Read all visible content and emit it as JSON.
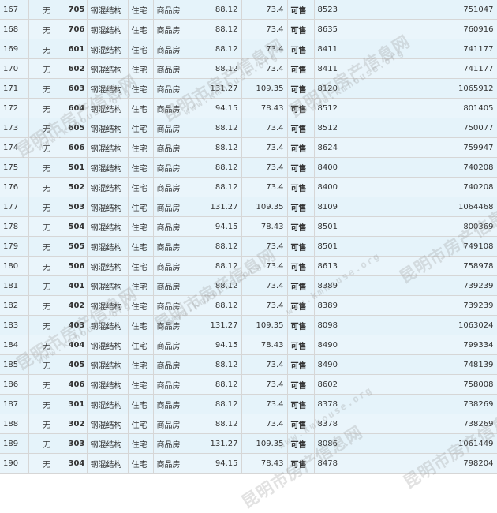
{
  "watermark": {
    "cn": "昆明市房产信息网",
    "en": "www.kmhouse.org"
  },
  "status_color": "#0a7a0a",
  "rows": [
    {
      "seq": "167",
      "none": "无",
      "room": "705",
      "structure": "钢混结构",
      "use": "住宅",
      "type": "商品房",
      "area": "88.12",
      "inner": "73.4",
      "status": "可售",
      "price": "8523",
      "total": "751047"
    },
    {
      "seq": "168",
      "none": "无",
      "room": "706",
      "structure": "钢混结构",
      "use": "住宅",
      "type": "商品房",
      "area": "88.12",
      "inner": "73.4",
      "status": "可售",
      "price": "8635",
      "total": "760916"
    },
    {
      "seq": "169",
      "none": "无",
      "room": "601",
      "structure": "钢混结构",
      "use": "住宅",
      "type": "商品房",
      "area": "88.12",
      "inner": "73.4",
      "status": "可售",
      "price": "8411",
      "total": "741177"
    },
    {
      "seq": "170",
      "none": "无",
      "room": "602",
      "structure": "钢混结构",
      "use": "住宅",
      "type": "商品房",
      "area": "88.12",
      "inner": "73.4",
      "status": "可售",
      "price": "8411",
      "total": "741177"
    },
    {
      "seq": "171",
      "none": "无",
      "room": "603",
      "structure": "钢混结构",
      "use": "住宅",
      "type": "商品房",
      "area": "131.27",
      "inner": "109.35",
      "status": "可售",
      "price": "8120",
      "total": "1065912"
    },
    {
      "seq": "172",
      "none": "无",
      "room": "604",
      "structure": "钢混结构",
      "use": "住宅",
      "type": "商品房",
      "area": "94.15",
      "inner": "78.43",
      "status": "可售",
      "price": "8512",
      "total": "801405"
    },
    {
      "seq": "173",
      "none": "无",
      "room": "605",
      "structure": "钢混结构",
      "use": "住宅",
      "type": "商品房",
      "area": "88.12",
      "inner": "73.4",
      "status": "可售",
      "price": "8512",
      "total": "750077"
    },
    {
      "seq": "174",
      "none": "无",
      "room": "606",
      "structure": "钢混结构",
      "use": "住宅",
      "type": "商品房",
      "area": "88.12",
      "inner": "73.4",
      "status": "可售",
      "price": "8624",
      "total": "759947"
    },
    {
      "seq": "175",
      "none": "无",
      "room": "501",
      "structure": "钢混结构",
      "use": "住宅",
      "type": "商品房",
      "area": "88.12",
      "inner": "73.4",
      "status": "可售",
      "price": "8400",
      "total": "740208"
    },
    {
      "seq": "176",
      "none": "无",
      "room": "502",
      "structure": "钢混结构",
      "use": "住宅",
      "type": "商品房",
      "area": "88.12",
      "inner": "73.4",
      "status": "可售",
      "price": "8400",
      "total": "740208"
    },
    {
      "seq": "177",
      "none": "无",
      "room": "503",
      "structure": "钢混结构",
      "use": "住宅",
      "type": "商品房",
      "area": "131.27",
      "inner": "109.35",
      "status": "可售",
      "price": "8109",
      "total": "1064468"
    },
    {
      "seq": "178",
      "none": "无",
      "room": "504",
      "structure": "钢混结构",
      "use": "住宅",
      "type": "商品房",
      "area": "94.15",
      "inner": "78.43",
      "status": "可售",
      "price": "8501",
      "total": "800369"
    },
    {
      "seq": "179",
      "none": "无",
      "room": "505",
      "structure": "钢混结构",
      "use": "住宅",
      "type": "商品房",
      "area": "88.12",
      "inner": "73.4",
      "status": "可售",
      "price": "8501",
      "total": "749108"
    },
    {
      "seq": "180",
      "none": "无",
      "room": "506",
      "structure": "钢混结构",
      "use": "住宅",
      "type": "商品房",
      "area": "88.12",
      "inner": "73.4",
      "status": "可售",
      "price": "8613",
      "total": "758978"
    },
    {
      "seq": "181",
      "none": "无",
      "room": "401",
      "structure": "钢混结构",
      "use": "住宅",
      "type": "商品房",
      "area": "88.12",
      "inner": "73.4",
      "status": "可售",
      "price": "8389",
      "total": "739239"
    },
    {
      "seq": "182",
      "none": "无",
      "room": "402",
      "structure": "钢混结构",
      "use": "住宅",
      "type": "商品房",
      "area": "88.12",
      "inner": "73.4",
      "status": "可售",
      "price": "8389",
      "total": "739239"
    },
    {
      "seq": "183",
      "none": "无",
      "room": "403",
      "structure": "钢混结构",
      "use": "住宅",
      "type": "商品房",
      "area": "131.27",
      "inner": "109.35",
      "status": "可售",
      "price": "8098",
      "total": "1063024"
    },
    {
      "seq": "184",
      "none": "无",
      "room": "404",
      "structure": "钢混结构",
      "use": "住宅",
      "type": "商品房",
      "area": "94.15",
      "inner": "78.43",
      "status": "可售",
      "price": "8490",
      "total": "799334"
    },
    {
      "seq": "185",
      "none": "无",
      "room": "405",
      "structure": "钢混结构",
      "use": "住宅",
      "type": "商品房",
      "area": "88.12",
      "inner": "73.4",
      "status": "可售",
      "price": "8490",
      "total": "748139"
    },
    {
      "seq": "186",
      "none": "无",
      "room": "406",
      "structure": "钢混结构",
      "use": "住宅",
      "type": "商品房",
      "area": "88.12",
      "inner": "73.4",
      "status": "可售",
      "price": "8602",
      "total": "758008"
    },
    {
      "seq": "187",
      "none": "无",
      "room": "301",
      "structure": "钢混结构",
      "use": "住宅",
      "type": "商品房",
      "area": "88.12",
      "inner": "73.4",
      "status": "可售",
      "price": "8378",
      "total": "738269"
    },
    {
      "seq": "188",
      "none": "无",
      "room": "302",
      "structure": "钢混结构",
      "use": "住宅",
      "type": "商品房",
      "area": "88.12",
      "inner": "73.4",
      "status": "可售",
      "price": "8378",
      "total": "738269"
    },
    {
      "seq": "189",
      "none": "无",
      "room": "303",
      "structure": "钢混结构",
      "use": "住宅",
      "type": "商品房",
      "area": "131.27",
      "inner": "109.35",
      "status": "可售",
      "price": "8086",
      "total": "1061449"
    },
    {
      "seq": "190",
      "none": "无",
      "room": "304",
      "structure": "钢混结构",
      "use": "住宅",
      "type": "商品房",
      "area": "94.15",
      "inner": "78.43",
      "status": "可售",
      "price": "8478",
      "total": "798204"
    }
  ]
}
